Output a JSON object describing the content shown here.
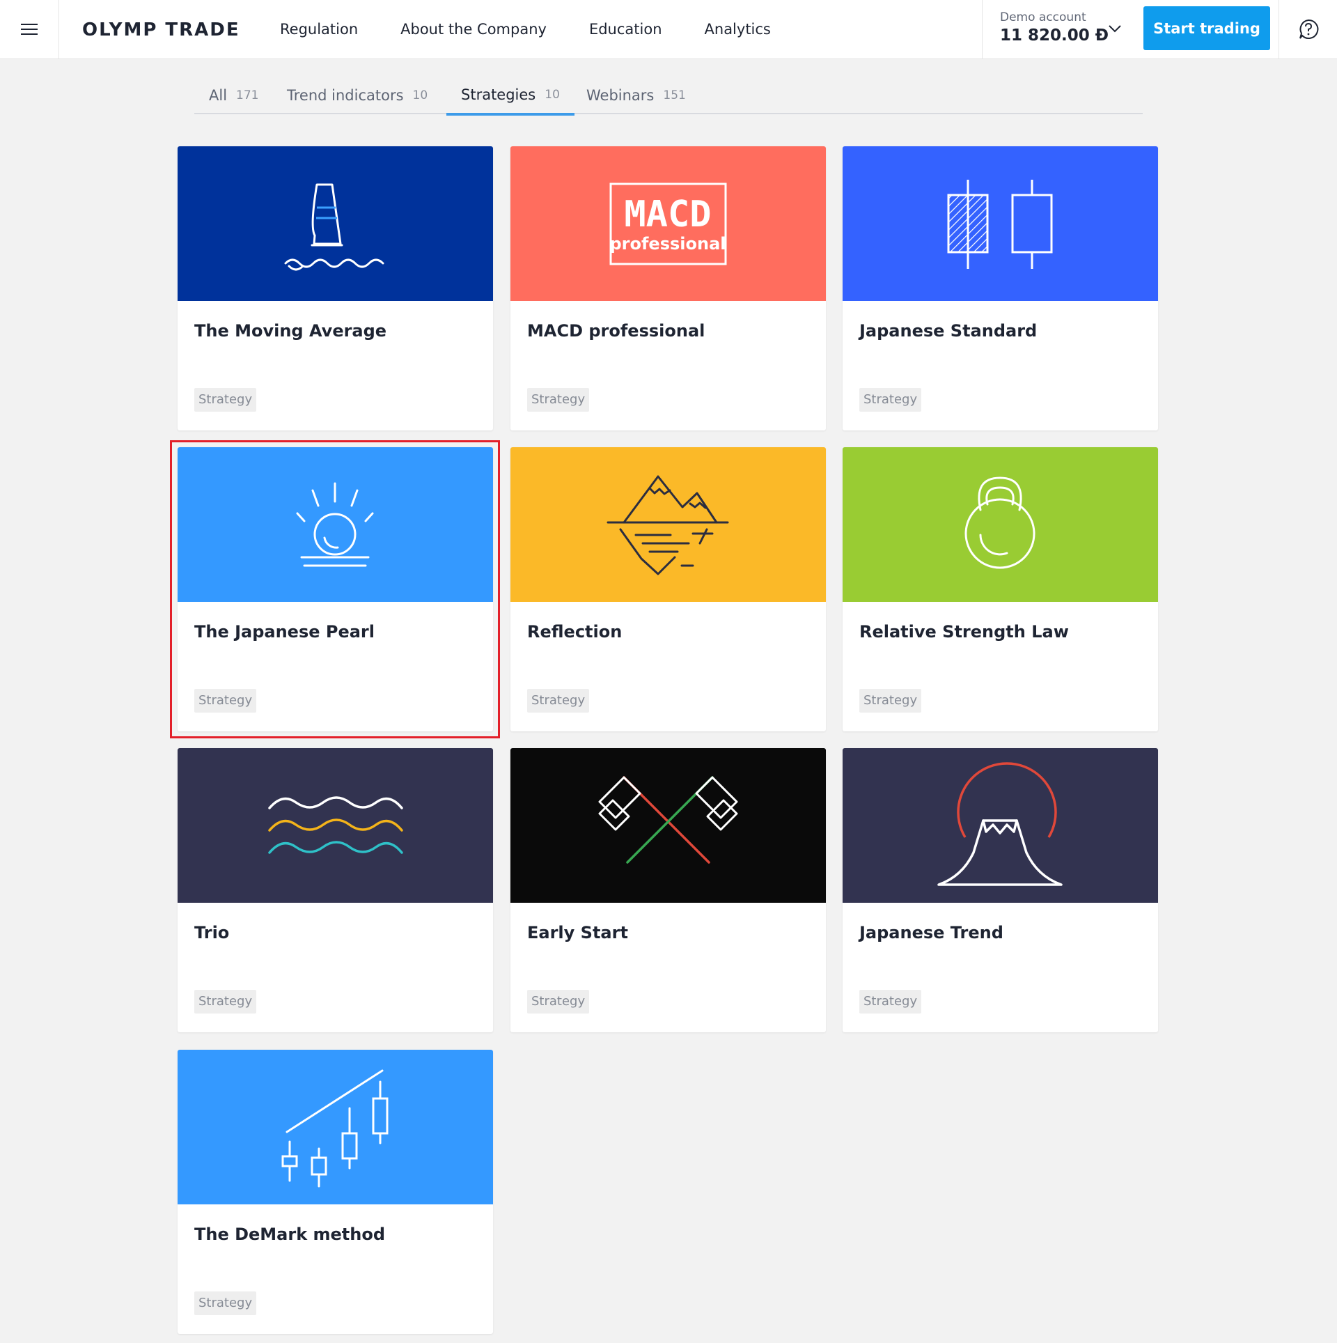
{
  "header": {
    "logo": "OLYMP TRADE",
    "menu_icon": "hamburger-icon",
    "nav": [
      "Regulation",
      "About the Company",
      "Education",
      "Analytics"
    ],
    "account_label": "Demo account",
    "account_balance": "11 820.00 Đ",
    "start_button": "Start trading",
    "help_icon": "question-icon"
  },
  "tabs": [
    {
      "label": "All",
      "count": "171",
      "active": false
    },
    {
      "label": "Trend indicators",
      "count": "10",
      "active": false
    },
    {
      "label": "Strategies",
      "count": "10",
      "active": true
    },
    {
      "label": "Webinars",
      "count": "151",
      "active": false
    }
  ],
  "cards": [
    {
      "title": "The Moving Average",
      "tag": "Strategy",
      "color": "#00329b",
      "icon": "windsurf-icon"
    },
    {
      "title": "MACD professional",
      "tag": "Strategy",
      "color": "#ff6d5e",
      "icon": "macd-logo-icon"
    },
    {
      "title": "Japanese Standard",
      "tag": "Strategy",
      "color": "#3462ff",
      "icon": "candlesticks-icon"
    },
    {
      "title": "The Japanese Pearl",
      "tag": "Strategy",
      "color": "#3499ff",
      "icon": "sunrise-icon",
      "selected": true
    },
    {
      "title": "Reflection",
      "tag": "Strategy",
      "color": "#fbb928",
      "icon": "mountain-reflection-icon"
    },
    {
      "title": "Relative Strength Law",
      "tag": "Strategy",
      "color": "#99cc33",
      "icon": "kettlebell-icon"
    },
    {
      "title": "Trio",
      "tag": "Strategy",
      "color": "#323350",
      "icon": "three-waves-icon"
    },
    {
      "title": "Early Start",
      "tag": "Strategy",
      "color": "#0a0a0a",
      "icon": "crossed-flags-icon"
    },
    {
      "title": "Japanese Trend",
      "tag": "Strategy",
      "color": "#323350",
      "icon": "mount-fuji-icon"
    },
    {
      "title": "The DeMark method",
      "tag": "Strategy",
      "color": "#3499ff",
      "icon": "rising-candles-icon"
    }
  ],
  "macd_logo": {
    "line1": "MACD",
    "line2": "professional"
  }
}
